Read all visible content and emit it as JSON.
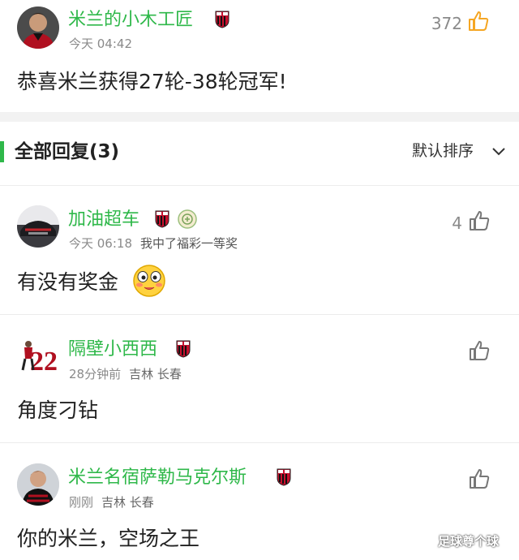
{
  "post": {
    "username": "米兰的小木工匠",
    "time": "今天 04:42",
    "likes": "372",
    "text": "恭喜米兰获得27轮-38轮冠军!"
  },
  "replies_header": {
    "title": "全部回复(3)",
    "sort_label": "默认排序"
  },
  "replies": [
    {
      "username": "加油超车",
      "time": "今天 06:18",
      "note": "我中了福彩一等奖",
      "likes": "4",
      "text": "有没有奖金"
    },
    {
      "username": "隔壁小西西",
      "time": "28分钟前",
      "location": "吉林 长春",
      "likes": "",
      "text": "角度刁钻"
    },
    {
      "username": "米兰名宿萨勒马克尔斯",
      "time": "刚刚",
      "location": "吉林 长春",
      "likes": "",
      "text": "你的米兰，空场之王"
    }
  ],
  "watermark": "足球尊个球",
  "colors": {
    "accent_green": "#2fb84a",
    "meta_gray": "#8a8a8a",
    "like_orange": "#f5a623",
    "badge_red": "#c8102e"
  }
}
